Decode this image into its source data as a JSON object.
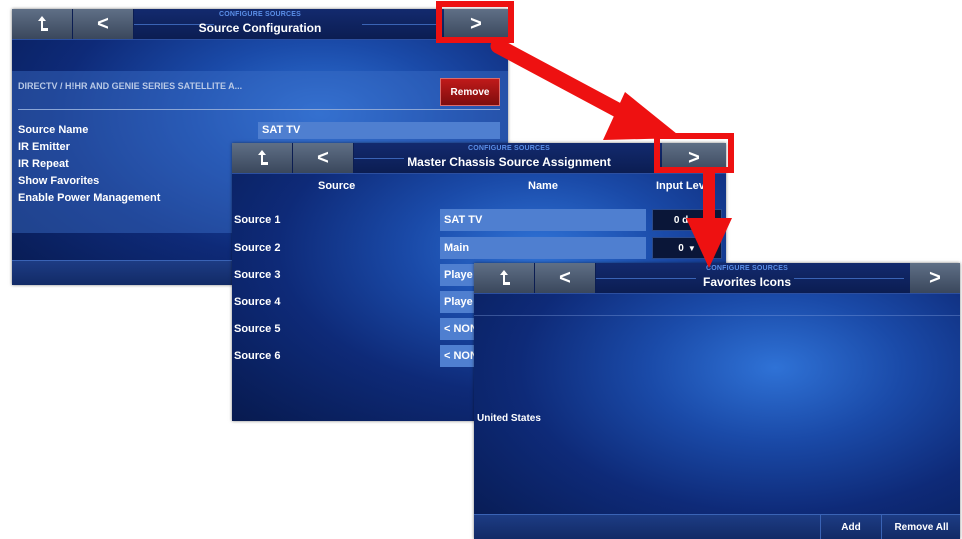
{
  "screen1": {
    "super_title": "CONFIGURE SOURCES",
    "title": "Source Configuration",
    "home_glyph": "↰",
    "back_glyph": "<",
    "next_glyph": ">",
    "device_name": "DIRECTV / H!HR AND GENIE SERIES SATELLITE A...",
    "remove_label": "Remove",
    "rows": [
      {
        "label": "Source Name",
        "value": "SAT TV"
      },
      {
        "label": "IR Emitter"
      },
      {
        "label": "IR Repeat"
      },
      {
        "label": "Show Favorites"
      },
      {
        "label": "Enable Power Management"
      }
    ]
  },
  "screen2": {
    "super_title": "CONFIGURE SOURCES",
    "title": "Master Chassis Source Assignment",
    "back_glyph": "<",
    "next_glyph": ">",
    "headers": {
      "source": "Source",
      "name": "Name",
      "input_level": "Input Level"
    },
    "rows": [
      {
        "source": "Source 1",
        "name": "SAT TV",
        "level": "0 d"
      },
      {
        "source": "Source 2",
        "name": "Main",
        "level": "0"
      },
      {
        "source": "Source 3",
        "name": "Playe"
      },
      {
        "source": "Source 4",
        "name": "Playe"
      },
      {
        "source": "Source 5",
        "name": "< NON"
      },
      {
        "source": "Source 6",
        "name": "< NON"
      }
    ]
  },
  "screen3": {
    "super_title": "CONFIGURE SOURCES",
    "title": "Favorites Icons",
    "back_glyph": "<",
    "next_glyph": ">",
    "list_item": "United States",
    "add_label": "Add",
    "remove_all_label": "Remove All"
  },
  "colors": {
    "highlight": "#ee1111",
    "panel_bg": "#0e2a78",
    "field": "#4f7fd0",
    "remove_button": "#a31212"
  }
}
